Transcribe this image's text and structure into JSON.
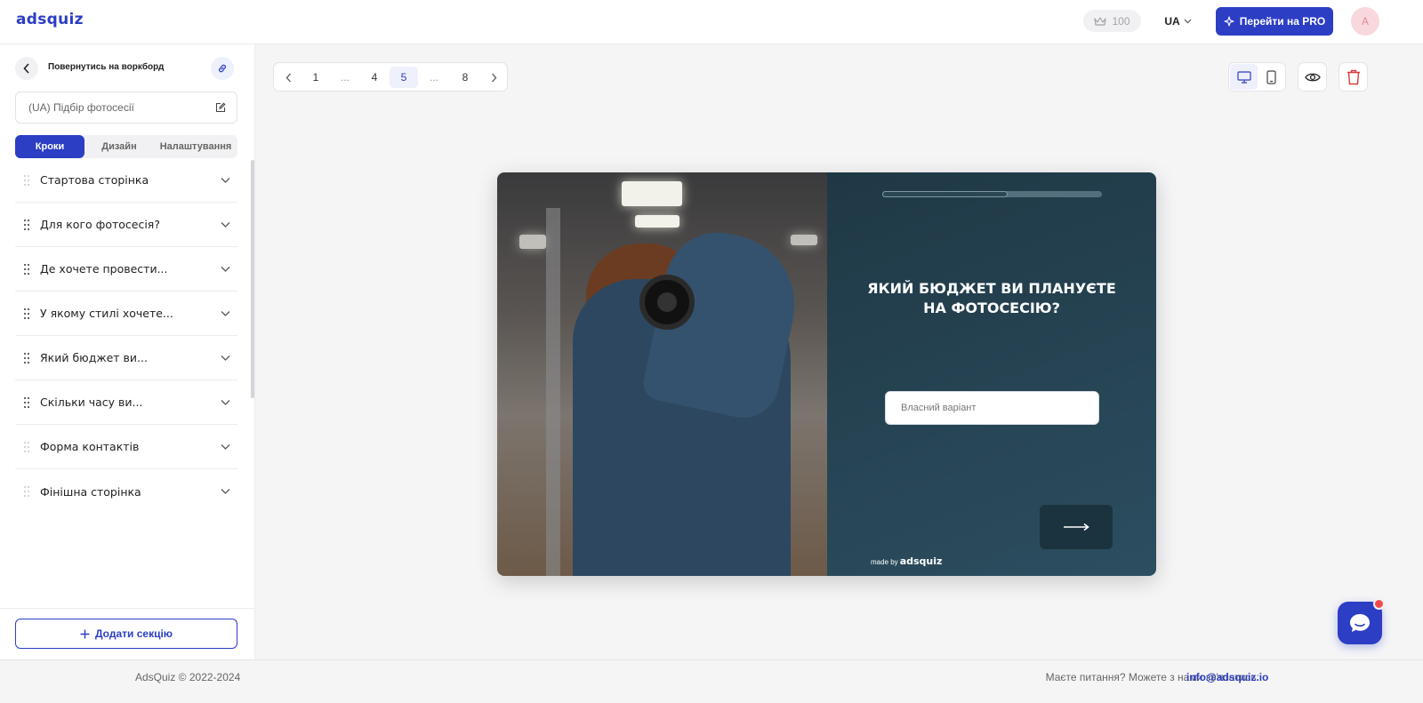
{
  "header": {
    "logo": "adsquiz",
    "coins": "100",
    "language": "UA",
    "pro_button": "Перейти на PRO",
    "avatar_initial": "A"
  },
  "sidebar": {
    "back_label": "Повернутись на воркборд",
    "quiz_name": "(UA) Підбір фотосесії",
    "tabs": [
      {
        "label": "Кроки",
        "active": true
      },
      {
        "label": "Дизайн",
        "active": false
      },
      {
        "label": "Налаштування",
        "active": false
      }
    ],
    "steps": [
      {
        "label": "Стартова сторінка",
        "draggable": false
      },
      {
        "label": "Для кого фотосесія?",
        "draggable": true
      },
      {
        "label": "Де хочете провести...",
        "draggable": true
      },
      {
        "label": "У якому стилі хочете...",
        "draggable": true
      },
      {
        "label": "Який бюджет ви...",
        "draggable": true
      },
      {
        "label": "Скільки часу ви...",
        "draggable": true
      },
      {
        "label": "Форма контактів",
        "draggable": false
      },
      {
        "label": "Фінішна сторінка",
        "draggable": false
      }
    ],
    "add_section": "Додати секцію"
  },
  "pager": {
    "pages": [
      "1",
      "...",
      "4",
      "5",
      "...",
      "8"
    ],
    "active_page": "5"
  },
  "preview": {
    "question": "ЯКИЙ БЮДЖЕТ ВИ ПЛАНУЄТЕ НА ФОТОСЕСІЮ?",
    "answer_placeholder": "Власний варіант",
    "progress": 0.57,
    "made_by_prefix": "made by",
    "made_by_brand": "adsquiz"
  },
  "footer": {
    "copyright": "AdsQuiz © 2022-2024",
    "contact_text": "Маєте питання? Можете з нами зв'язатись:",
    "email": "info@adsquiz.io"
  },
  "colors": {
    "brand": "#2c3ec4",
    "quiz_bg": "#1f3845",
    "danger": "#d93a3a"
  }
}
